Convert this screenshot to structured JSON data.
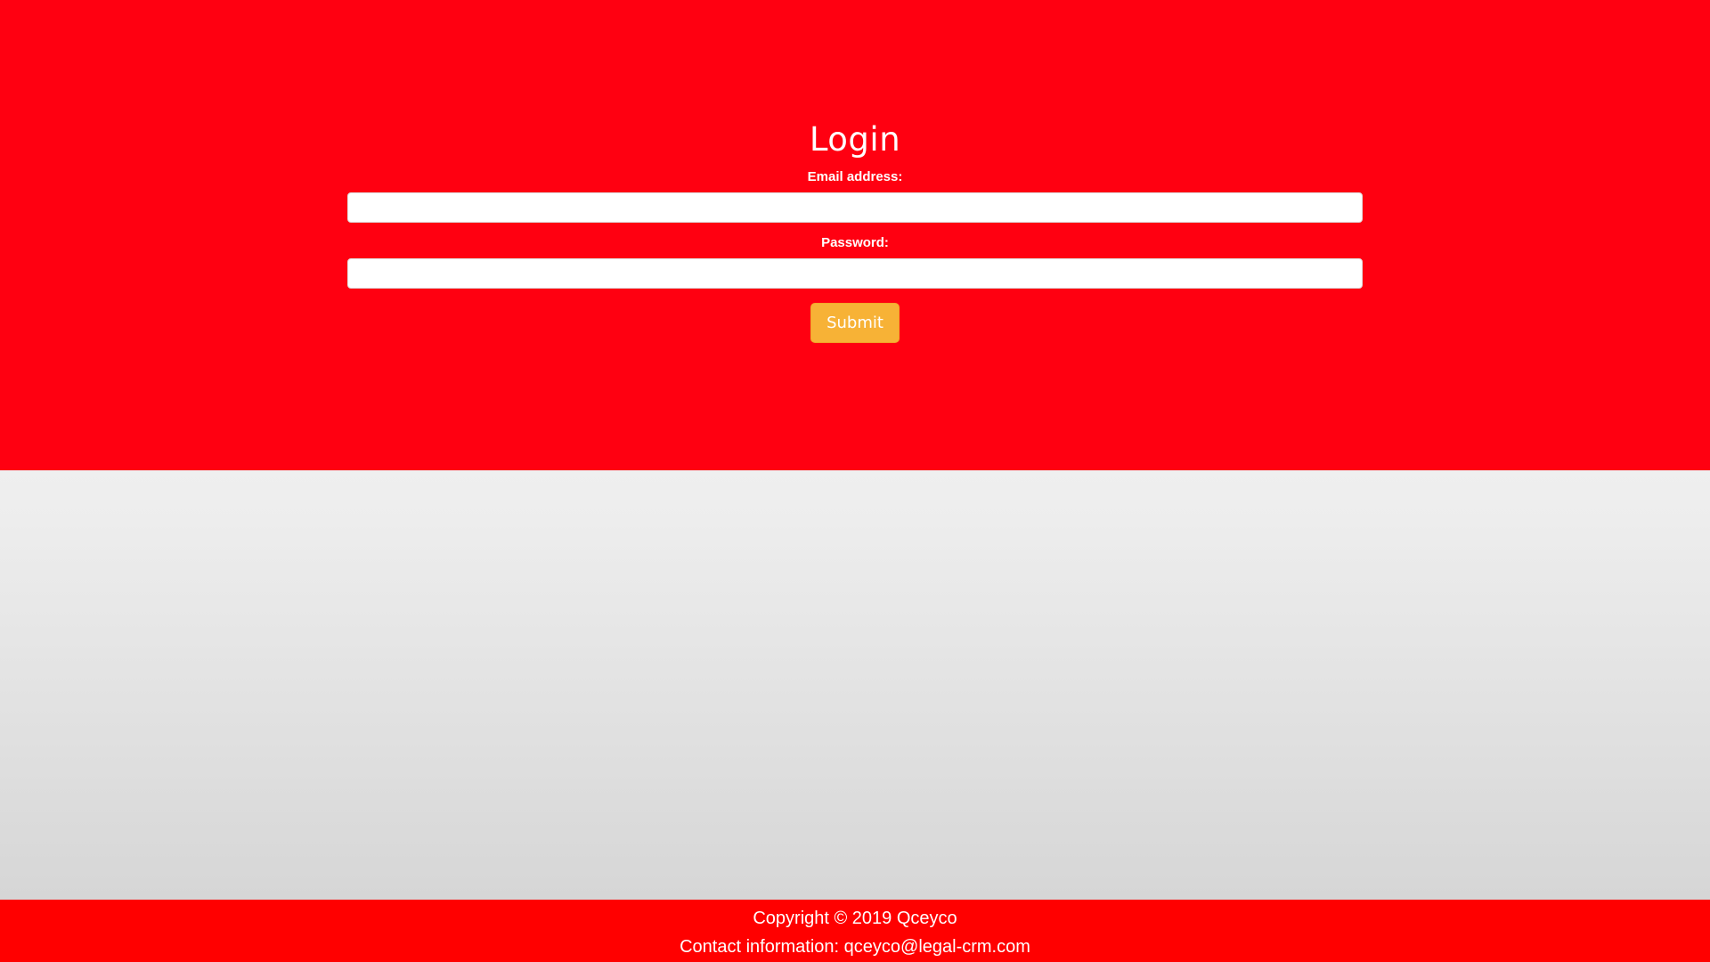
{
  "login": {
    "title": "Login",
    "email_label": "Email address:",
    "email_value": "",
    "email_placeholder": "",
    "password_label": "Password:",
    "password_value": "",
    "password_placeholder": "",
    "submit_label": "Submit"
  },
  "footer": {
    "copyright": "Copyright © 2019 Qceyco",
    "contact": "Contact information: qceyco@legal-crm.com"
  },
  "colors": {
    "hero_background": "#ff0011",
    "footer_background": "#ff0000",
    "submit_button": "#f7b236",
    "page_gradient_top": "#efefef",
    "page_gradient_bottom": "#d6d6d6",
    "text_on_red": "#ffffff"
  }
}
